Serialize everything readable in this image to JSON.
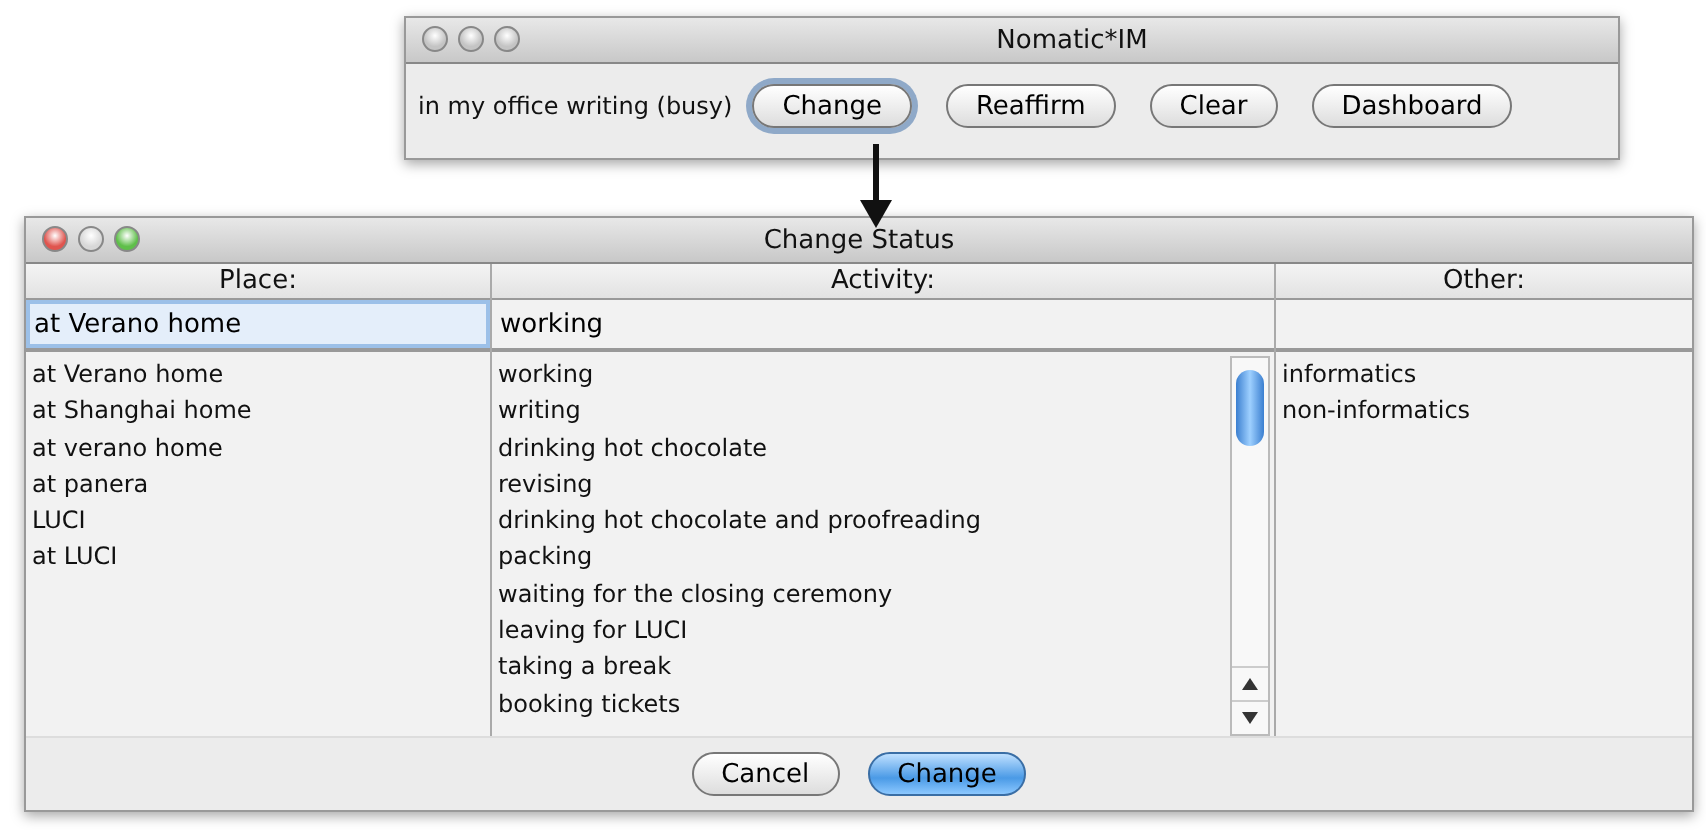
{
  "main_window": {
    "title": "Nomatic*IM",
    "active": false,
    "status": "in my office writing (busy)",
    "buttons": [
      {
        "label": "Change",
        "focused": true
      },
      {
        "label": "Reaffirm",
        "focused": false
      },
      {
        "label": "Clear",
        "focused": false
      },
      {
        "label": "Dashboard",
        "focused": false
      }
    ]
  },
  "dialog": {
    "title": "Change Status",
    "active": true,
    "columns": [
      {
        "heading": "Place:",
        "field": {
          "value": "at Verano home",
          "focused": true
        },
        "items": [
          "at Verano home",
          "at Shanghai home",
          "at verano home",
          "at panera",
          "LUCI",
          "at LUCI"
        ],
        "scrollbar": false
      },
      {
        "heading": "Activity:",
        "field": {
          "value": "working",
          "focused": false
        },
        "items": [
          "working",
          "writing",
          "drinking hot chocolate",
          "revising",
          "drinking hot chocolate and proofreading",
          "packing",
          "waiting for the closing ceremony",
          "leaving for LUCI",
          "taking a break",
          "booking tickets"
        ],
        "scrollbar": true
      },
      {
        "heading": "Other:",
        "field": {
          "focused": false
        },
        "items": [
          "informatics",
          "non-informatics"
        ],
        "scrollbar": false
      }
    ],
    "buttons": [
      {
        "label": "Cancel",
        "default": false
      },
      {
        "label": "Change",
        "default": true
      }
    ]
  }
}
